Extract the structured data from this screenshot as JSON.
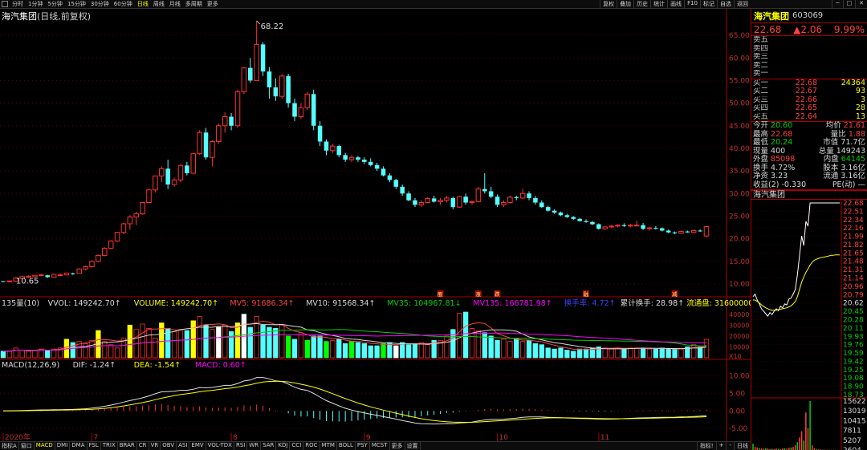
{
  "toolbar": {
    "timeframes": [
      "分时",
      "1分钟",
      "5分钟",
      "15分钟",
      "30分钟",
      "60分钟",
      "日线",
      "周线",
      "月线",
      "多周期",
      "更多"
    ],
    "active_timeframe": 6,
    "right_buttons": [
      "复权",
      "叠加",
      "历史",
      "统计",
      "画线",
      "F10",
      "标记",
      "自选",
      "返回"
    ]
  },
  "chart_title": {
    "name": "海汽集团",
    "sub": "(日线,前复权)"
  },
  "stock": {
    "name": "海汽集团",
    "code": "603069",
    "price": "22.68",
    "change": "▲2.06",
    "pct": "9.99%"
  },
  "order_book": {
    "sell": [
      {
        "label": "卖五",
        "price": "",
        "vol": ""
      },
      {
        "label": "卖四",
        "price": "",
        "vol": ""
      },
      {
        "label": "卖三",
        "price": "",
        "vol": ""
      },
      {
        "label": "卖二",
        "price": "",
        "vol": ""
      },
      {
        "label": "卖一",
        "price": "",
        "vol": ""
      }
    ],
    "buy": [
      {
        "label": "买一",
        "price": "22.68",
        "vol": "24364"
      },
      {
        "label": "买二",
        "price": "22.67",
        "vol": "93"
      },
      {
        "label": "买三",
        "price": "22.66",
        "vol": "3"
      },
      {
        "label": "买四",
        "price": "22.65",
        "vol": "28"
      },
      {
        "label": "买五",
        "price": "22.64",
        "vol": "13"
      }
    ]
  },
  "stats": [
    {
      "l1": "今开",
      "v1": "20.60",
      "c1": "grn",
      "l2": "均价",
      "v2": "21.61",
      "c2": "red"
    },
    {
      "l1": "最高",
      "v1": "22.68",
      "c1": "red",
      "l2": "量比",
      "v2": "1.88",
      "c2": "red"
    },
    {
      "l1": "最低",
      "v1": "20.24",
      "c1": "grn",
      "l2": "市值",
      "v2": "71.7亿",
      "c2": "wht"
    },
    {
      "l1": "现量",
      "v1": "400",
      "c1": "wht",
      "l2": "总量",
      "v2": "149243",
      "c2": "wht"
    },
    {
      "l1": "外盘",
      "v1": "85098",
      "c1": "red",
      "l2": "内盘",
      "v2": "64145",
      "c2": "grn"
    },
    {
      "l1": "换手",
      "v1": "4.72%",
      "c1": "wht",
      "l2": "股本",
      "v2": "3.16亿",
      "c2": "wht"
    },
    {
      "l1": "净资",
      "v1": "3.23",
      "c1": "wht",
      "l2": "流通",
      "v2": "3.16亿",
      "c2": "wht"
    },
    {
      "l1": "收益(2)",
      "v1": "-0.330",
      "c1": "wht",
      "l2": "PE(动)",
      "v2": "—",
      "c2": "wht"
    }
  ],
  "mini_title": "海汽集团",
  "mini_price_labels": [
    "22.68",
    "22.51",
    "22.34",
    "22.16",
    "21.99",
    "21.82",
    "21.65",
    "21.48",
    "21.31",
    "21.14",
    "20.96",
    "20.79",
    "20.62",
    "20.45",
    "20.28",
    "20.11",
    "19.93",
    "19.76",
    "19.59",
    "19.42",
    "19.25",
    "19.08",
    "18.90",
    "18.73"
  ],
  "mini_vol_labels": [
    "15622",
    "13019",
    "10415",
    "7811",
    "5207",
    "2604"
  ],
  "price_axis": [
    "65.00",
    "60.00",
    "55.00",
    "50.00",
    "45.00",
    "40.00",
    "35.00",
    "30.00",
    "25.00",
    "20.00",
    "15.00",
    "10.00"
  ],
  "vol_axis": [
    "40000",
    "30000",
    "20000",
    "10000",
    "X10"
  ],
  "macd_axis": [
    "10.00",
    "5.00",
    "0.00",
    "-5.00"
  ],
  "vol_legend": [
    {
      "t": "135量(10)",
      "c": "#d8d8d8"
    },
    {
      "t": "VVOL: 149242.70↑",
      "c": "#d8d8d8"
    },
    {
      "t": "VOLUME: 149242.70↑",
      "c": "#ffff00"
    },
    {
      "t": "MV5: 91686.34↑",
      "c": "#ff4040"
    },
    {
      "t": "MV10: 91568.34↑",
      "c": "#d8d8d8"
    },
    {
      "t": "MV35: 104967.81↓",
      "c": "#00d000"
    },
    {
      "t": "MV135: 166781.98↑",
      "c": "#ff00ff"
    },
    {
      "t": "换手率: 4.72↑",
      "c": "#4040ff"
    },
    {
      "t": "累计换手: 28.98↑",
      "c": "#d8d8d8"
    },
    {
      "t": "流通盘: 316000000",
      "c": "#ffff00"
    }
  ],
  "macd_legend": [
    {
      "t": "MACD(12,26,9)",
      "c": "#d8d8d8"
    },
    {
      "t": "DIF: -1.24↑",
      "c": "#d8d8d8"
    },
    {
      "t": "DEA: -1.54↑",
      "c": "#ffff00"
    },
    {
      "t": "MACD: 0.60↑",
      "c": "#ff00ff"
    }
  ],
  "date_labels": [
    {
      "t": "2020年",
      "i": 0
    },
    {
      "t": "7",
      "i": 14
    },
    {
      "t": "8",
      "i": 36
    },
    {
      "t": "9",
      "i": 57
    },
    {
      "t": "10",
      "i": 78
    },
    {
      "t": "11",
      "i": 94
    }
  ],
  "bottom_tabs": [
    "指标A",
    "窗口",
    "MACD",
    "DMI",
    "DMA",
    "FSL",
    "TRIX",
    "BRAR",
    "CR",
    "VR",
    "OBV",
    "ASI",
    "EMV",
    "VOL-TDX",
    "RSI",
    "WR",
    "SAR",
    "KDJ",
    "CCI",
    "ROC",
    "MTM",
    "BOLL",
    "PSY",
    "MCST",
    "更多",
    "设置"
  ],
  "bottom_right": [
    "指标!",
    "+",
    "-",
    "日线"
  ],
  "chart_data": {
    "type": "candlestick",
    "annotations": [
      {
        "t": "68.22",
        "i": 40
      },
      {
        "t": "10.65",
        "i": 1
      }
    ],
    "markers": [
      {
        "t": "股",
        "i": 69
      },
      {
        "t": "涨",
        "i": 75
      },
      {
        "t": "跌",
        "i": 78
      },
      {
        "t": "融",
        "i": 92
      },
      {
        "t": "减",
        "i": 106
      }
    ],
    "candles": [
      [
        10.6,
        10.65,
        10.4,
        10.55
      ],
      [
        10.55,
        10.7,
        10.45,
        10.65
      ],
      [
        10.6,
        11.5,
        10.5,
        11.3
      ],
      [
        11.2,
        11.8,
        11.0,
        11.6
      ],
      [
        11.5,
        11.9,
        11.3,
        11.7
      ],
      [
        11.6,
        12.0,
        11.4,
        11.9
      ],
      [
        11.9,
        12.2,
        11.7,
        12.0
      ],
      [
        11.9,
        12.0,
        11.3,
        11.5
      ],
      [
        11.5,
        12.2,
        11.4,
        12.1
      ],
      [
        12.0,
        12.3,
        11.8,
        12.0
      ],
      [
        12.0,
        12.5,
        11.9,
        12.4
      ],
      [
        12.3,
        12.5,
        12.0,
        12.2
      ],
      [
        12.3,
        13.5,
        12.2,
        13.3
      ],
      [
        13.3,
        14.0,
        13.0,
        13.8
      ],
      [
        13.8,
        15.2,
        13.6,
        15.0
      ],
      [
        15.0,
        16.5,
        14.8,
        16.3
      ],
      [
        16.3,
        18.1,
        16.1,
        17.9
      ],
      [
        17.9,
        19.7,
        17.7,
        19.5
      ],
      [
        19.5,
        21.5,
        19.3,
        21.4
      ],
      [
        21.4,
        23.5,
        21.0,
        23.3
      ],
      [
        23.3,
        25.2,
        22.0,
        24.8
      ],
      [
        24.8,
        26.0,
        23.0,
        25.5
      ],
      [
        25.5,
        28.1,
        25.3,
        28.0
      ],
      [
        28.0,
        31.0,
        28.0,
        30.8
      ],
      [
        30.8,
        33.9,
        30.2,
        33.9
      ],
      [
        33.9,
        36.0,
        32.5,
        35.5
      ],
      [
        35.5,
        37.5,
        31.0,
        32.0
      ],
      [
        32.0,
        33.5,
        31.5,
        33.0
      ],
      [
        33.0,
        36.5,
        32.5,
        36.2
      ],
      [
        36.2,
        37.0,
        34.0,
        34.5
      ],
      [
        34.5,
        39.0,
        34.2,
        38.8
      ],
      [
        38.8,
        44.0,
        38.5,
        43.5
      ],
      [
        43.5,
        44.5,
        37.5,
        38.0
      ],
      [
        38.0,
        41.8,
        36.0,
        41.5
      ],
      [
        41.5,
        45.5,
        41.0,
        45.0
      ],
      [
        45.0,
        48.0,
        43.5,
        47.0
      ],
      [
        47.0,
        47.8,
        44.0,
        45.0
      ],
      [
        45.0,
        53.0,
        44.5,
        52.5
      ],
      [
        52.5,
        58.0,
        52.0,
        57.8
      ],
      [
        57.8,
        60.0,
        54.5,
        55.0
      ],
      [
        55.0,
        68.22,
        55.0,
        63.0
      ],
      [
        63.0,
        63.5,
        56.0,
        57.0
      ],
      [
        57.0,
        58.0,
        51.0,
        53.5
      ],
      [
        53.5,
        55.5,
        50.5,
        51.5
      ],
      [
        51.5,
        56.5,
        51.0,
        56.0
      ],
      [
        56.0,
        56.5,
        49.0,
        50.0
      ],
      [
        50.0,
        51.0,
        46.0,
        47.0
      ],
      [
        47.0,
        50.0,
        46.5,
        49.0
      ],
      [
        49.0,
        52.5,
        48.5,
        52.0
      ],
      [
        52.0,
        53.0,
        44.0,
        45.0
      ],
      [
        45.0,
        46.0,
        40.5,
        41.5
      ],
      [
        41.5,
        42.0,
        38.5,
        39.5
      ],
      [
        39.5,
        41.0,
        39.0,
        40.5
      ],
      [
        40.5,
        40.8,
        38.0,
        38.5
      ],
      [
        38.5,
        39.0,
        37.0,
        37.5
      ],
      [
        37.5,
        38.5,
        37.0,
        38.0
      ],
      [
        38.0,
        38.3,
        37.0,
        37.5
      ],
      [
        37.5,
        38.0,
        36.5,
        37.0
      ],
      [
        37.0,
        37.8,
        36.0,
        36.3
      ],
      [
        36.3,
        36.8,
        35.0,
        35.5
      ],
      [
        35.5,
        36.0,
        33.8,
        34.0
      ],
      [
        34.0,
        34.5,
        32.5,
        33.0
      ],
      [
        33.0,
        33.2,
        31.0,
        31.5
      ],
      [
        31.5,
        32.0,
        29.5,
        30.0
      ],
      [
        30.0,
        30.5,
        28.3,
        28.5
      ],
      [
        28.5,
        29.0,
        27.0,
        27.5
      ],
      [
        27.5,
        28.5,
        27.0,
        28.0
      ],
      [
        28.0,
        29.2,
        27.8,
        28.9
      ],
      [
        28.9,
        29.5,
        28.0,
        28.2
      ],
      [
        28.2,
        29.0,
        27.5,
        28.5
      ],
      [
        28.5,
        29.5,
        28.0,
        29.0
      ],
      [
        29.0,
        29.3,
        26.5,
        27.0
      ],
      [
        27.0,
        29.5,
        26.8,
        29.3
      ],
      [
        29.3,
        30.0,
        27.5,
        28.0
      ],
      [
        28.0,
        28.5,
        27.5,
        28.2
      ],
      [
        28.2,
        31.5,
        28.0,
        31.0
      ],
      [
        31.0,
        34.5,
        30.0,
        30.5
      ],
      [
        30.5,
        31.5,
        29.0,
        29.3
      ],
      [
        29.3,
        29.8,
        27.0,
        27.5
      ],
      [
        27.5,
        28.5,
        27.0,
        28.0
      ],
      [
        28.0,
        29.5,
        27.8,
        29.2
      ],
      [
        29.2,
        29.5,
        28.5,
        29.0
      ],
      [
        29.0,
        31.0,
        28.8,
        30.0
      ],
      [
        30.0,
        30.5,
        28.5,
        29.0
      ],
      [
        29.0,
        29.5,
        27.5,
        28.0
      ],
      [
        28.0,
        28.5,
        26.8,
        27.0
      ],
      [
        27.0,
        27.3,
        26.0,
        26.2
      ],
      [
        26.2,
        26.5,
        25.5,
        25.8
      ],
      [
        25.8,
        26.0,
        25.0,
        25.2
      ],
      [
        25.2,
        25.5,
        24.6,
        24.8
      ],
      [
        24.8,
        25.0,
        24.2,
        24.4
      ],
      [
        24.4,
        24.6,
        23.8,
        23.9
      ],
      [
        23.9,
        24.3,
        23.5,
        23.7
      ],
      [
        23.7,
        23.9,
        23.0,
        23.2
      ],
      [
        23.2,
        23.4,
        22.0,
        22.2
      ],
      [
        22.2,
        22.8,
        22.0,
        22.6
      ],
      [
        22.6,
        23.0,
        22.4,
        22.8
      ],
      [
        22.8,
        23.2,
        22.5,
        23.0
      ],
      [
        23.0,
        23.4,
        22.6,
        22.8
      ],
      [
        22.8,
        23.3,
        22.5,
        23.0
      ],
      [
        23.0,
        24.0,
        22.8,
        23.0
      ],
      [
        23.0,
        23.5,
        21.9,
        22.2
      ],
      [
        22.2,
        22.6,
        21.8,
        22.4
      ],
      [
        22.4,
        22.8,
        22.0,
        22.3
      ],
      [
        22.3,
        22.5,
        21.6,
        21.8
      ],
      [
        21.8,
        22.0,
        21.2,
        21.4
      ],
      [
        21.4,
        21.6,
        21.0,
        21.2
      ],
      [
        21.2,
        21.8,
        21.1,
        21.6
      ],
      [
        21.6,
        21.8,
        21.3,
        21.4
      ],
      [
        21.4,
        22.0,
        21.3,
        21.8
      ],
      [
        21.8,
        22.1,
        21.5,
        21.7
      ],
      [
        20.6,
        22.68,
        20.24,
        22.68
      ]
    ],
    "volume_scale_max": 45000,
    "volumes": [
      6000,
      6000,
      9000,
      7000,
      6000,
      7000,
      8000,
      7000,
      8000,
      9000,
      17000,
      14000,
      15000,
      13000,
      16000,
      25000,
      15000,
      12000,
      9000,
      18000,
      30000,
      26000,
      31000,
      27000,
      18000,
      32000,
      27000,
      24000,
      26000,
      25000,
      34000,
      38000,
      30000,
      26000,
      28000,
      30000,
      24000,
      32000,
      40000,
      28000,
      38000,
      30000,
      28000,
      27000,
      30000,
      20000,
      17000,
      23000,
      16000,
      20000,
      20000,
      15000,
      16000,
      17000,
      13000,
      15000,
      14000,
      13000,
      11000,
      11000,
      13000,
      14000,
      11000,
      14000,
      12000,
      13000,
      14000,
      12000,
      16000,
      16000,
      20000,
      26000,
      41000,
      42000,
      27000,
      25000,
      23000,
      20000,
      16000,
      17000,
      15000,
      18000,
      15000,
      16000,
      13000,
      12000,
      9000,
      8000,
      9000,
      7000,
      6000,
      8000,
      8000,
      9000,
      10000,
      9000,
      8000,
      9000,
      8000,
      9000,
      9000,
      9000,
      8000,
      8000,
      9000,
      8000,
      8000,
      8000,
      10000,
      12000,
      10000,
      17000
    ],
    "macd_range": [
      -7.5,
      12
    ],
    "macd_hist_scale": 0.55
  }
}
